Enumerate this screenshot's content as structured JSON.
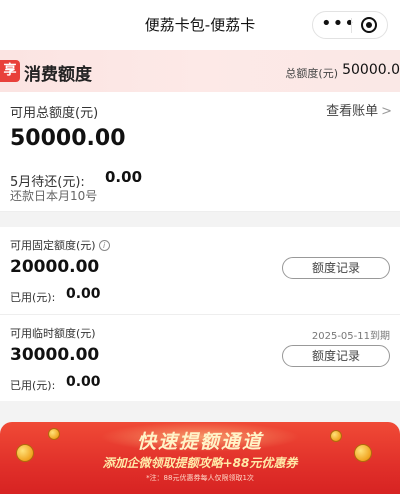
{
  "navbar": {
    "title": "便荔卡包-便荔卡",
    "more_icon": "more-dots-icon",
    "close_icon": "target-close-icon"
  },
  "band": {
    "icon_glyph": "享",
    "heading": "消费额度",
    "total_label": "总额度(元)",
    "total_value": "50000.0"
  },
  "summary": {
    "available_label": "可用总额度(元)",
    "view_bill": "查看账单",
    "available_amount": "50000.00",
    "due_label": "5月待还(元):",
    "due_value": "0.00",
    "due_date": "还款日本月10号"
  },
  "fixed": {
    "label": "可用固定额度(元)",
    "amount": "20000.00",
    "used_label": "已用(元):",
    "used_value": "0.00",
    "record_button": "额度记录"
  },
  "temporary": {
    "label": "可用临时额度(元)",
    "expiry": "2025-05-11到期",
    "amount": "30000.00",
    "used_label": "已用(元):",
    "used_value": "0.00",
    "record_button": "额度记录"
  },
  "promo": {
    "headline": "快速提额通道",
    "subline": "添加企微领取提额攻略+88元优惠券",
    "note": "*注：88元优惠券每人仅限领取1次"
  },
  "colors": {
    "brand_red": "#e8403a",
    "band_pink": "#fbe4e2",
    "promo_red": "#e1302a"
  }
}
